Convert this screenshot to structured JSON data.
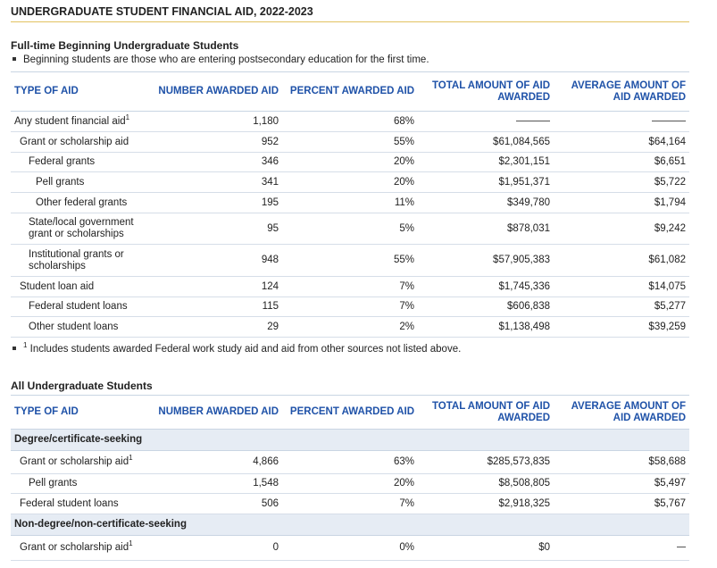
{
  "page_title": "UNDERGRADUATE STUDENT FINANCIAL AID, 2022-2023",
  "columns": {
    "type": "TYPE OF AID",
    "number": "NUMBER AWARDED AID",
    "percent": "PERCENT AWARDED AID",
    "total": "TOTAL AMOUNT OF AID AWARDED",
    "average": "AVERAGE AMOUNT OF AID AWARDED"
  },
  "section1": {
    "title": "Full-time Beginning Undergraduate Students",
    "note": "Beginning students are those who are entering postsecondary education for the first time.",
    "rows": [
      {
        "label": "Any student financial aid",
        "sup": "1",
        "number": "1,180",
        "percent": "68%",
        "total": "",
        "average": ""
      },
      {
        "label": "Grant or scholarship aid",
        "number": "952",
        "percent": "55%",
        "total": "$61,084,565",
        "average": "$64,164"
      },
      {
        "label": "Federal grants",
        "number": "346",
        "percent": "20%",
        "total": "$2,301,151",
        "average": "$6,651"
      },
      {
        "label": "Pell grants",
        "number": "341",
        "percent": "20%",
        "total": "$1,951,371",
        "average": "$5,722"
      },
      {
        "label": "Other federal grants",
        "number": "195",
        "percent": "11%",
        "total": "$349,780",
        "average": "$1,794"
      },
      {
        "label": "State/local government grant or scholarships",
        "number": "95",
        "percent": "5%",
        "total": "$878,031",
        "average": "$9,242"
      },
      {
        "label": "Institutional grants or scholarships",
        "number": "948",
        "percent": "55%",
        "total": "$57,905,383",
        "average": "$61,082"
      },
      {
        "label": "Student loan aid",
        "number": "124",
        "percent": "7%",
        "total": "$1,745,336",
        "average": "$14,075"
      },
      {
        "label": "Federal student loans",
        "number": "115",
        "percent": "7%",
        "total": "$606,838",
        "average": "$5,277"
      },
      {
        "label": "Other student loans",
        "number": "29",
        "percent": "2%",
        "total": "$1,138,498",
        "average": "$39,259"
      }
    ],
    "footnote_sup": "1",
    "footnote": "Includes students awarded Federal work study aid and aid from other sources not listed above."
  },
  "section2": {
    "title": "All Undergraduate Students",
    "group1": "Degree/certificate-seeking",
    "rows1": [
      {
        "label": "Grant or scholarship aid",
        "sup": "1",
        "number": "4,866",
        "percent": "63%",
        "total": "$285,573,835",
        "average": "$58,688"
      },
      {
        "label": "Pell grants",
        "number": "1,548",
        "percent": "20%",
        "total": "$8,508,805",
        "average": "$5,497"
      },
      {
        "label": "Federal student loans",
        "number": "506",
        "percent": "7%",
        "total": "$2,918,325",
        "average": "$5,767"
      }
    ],
    "group2": "Non-degree/non-certificate-seeking",
    "rows2": [
      {
        "label": "Grant or scholarship aid",
        "sup": "1",
        "number": "0",
        "percent": "0%",
        "total": "$0",
        "average": ""
      }
    ]
  }
}
